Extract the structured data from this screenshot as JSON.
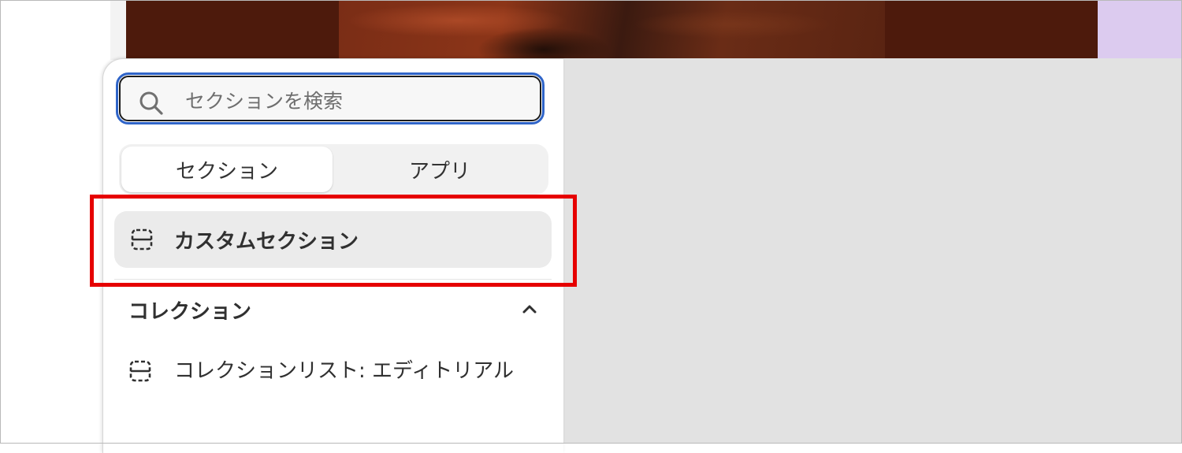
{
  "search": {
    "placeholder": "セクションを検索",
    "icon": "search-icon"
  },
  "tabs": [
    {
      "label": "セクション",
      "active": true
    },
    {
      "label": "アプリ",
      "active": false
    }
  ],
  "featured_item": {
    "label": "カスタムセクション",
    "icon": "section-icon"
  },
  "group": {
    "title": "コレクション",
    "expanded": true,
    "items": [
      {
        "label": "コレクションリスト: エディトリアル",
        "icon": "section-icon"
      }
    ]
  },
  "colors": {
    "focus_ring": "#2f64c8",
    "highlight": "#e60000",
    "canvas": "#e2e2e2",
    "accent_lilac": "#dccbef"
  }
}
